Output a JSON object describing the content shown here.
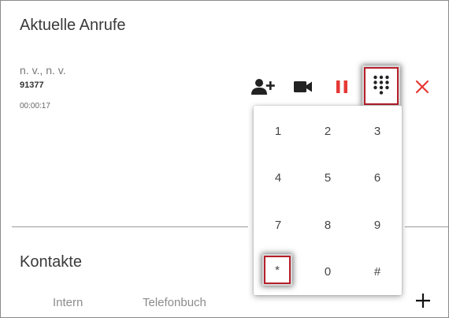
{
  "current_calls": {
    "title": "Aktuelle Anrufe",
    "caller_name": "n. v., n. v.",
    "caller_number": "91377",
    "duration": "00:00:17"
  },
  "actions": {
    "add_user": "add-user-icon",
    "video": "video-camera-icon",
    "pause": "pause-icon",
    "keypad": "dialpad-icon",
    "close": "close-icon"
  },
  "keypad": {
    "keys": [
      "1",
      "2",
      "3",
      "4",
      "5",
      "6",
      "7",
      "8",
      "9",
      "*",
      "0",
      "#"
    ],
    "highlighted_key": "*"
  },
  "contacts": {
    "title": "Kontakte",
    "tabs": [
      "Intern",
      "Telefonbuch"
    ]
  },
  "colors": {
    "accent_red": "#e53935",
    "icon_dark": "#222222",
    "highlight_border": "#b51f2a"
  }
}
